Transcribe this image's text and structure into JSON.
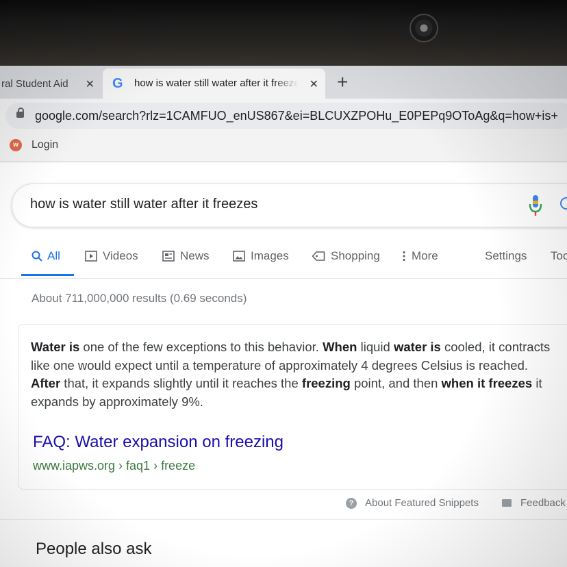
{
  "tabs": [
    {
      "label": "ral Student Aid",
      "close": "✕"
    },
    {
      "label": "how is water still water after it freezes",
      "close": "✕",
      "favicon": "G"
    }
  ],
  "new_tab": "+",
  "address_bar": {
    "url": "google.com/search?rlz=1CAMFUO_enUS867&ei=BLCUXZPOHu_E0PEPq9OToAg&q=how+is+"
  },
  "bookmarks": [
    {
      "label": "Login",
      "icon": "w"
    }
  ],
  "search": {
    "query": "how is water still water after it freezes"
  },
  "nav": {
    "tabs": [
      {
        "label": "All",
        "icon": "search-icon"
      },
      {
        "label": "Videos",
        "icon": "play-icon"
      },
      {
        "label": "News",
        "icon": "news-icon"
      },
      {
        "label": "Images",
        "icon": "image-icon"
      },
      {
        "label": "Shopping",
        "icon": "tag-icon"
      },
      {
        "label": "More",
        "icon": "more-vert-icon"
      }
    ],
    "settings": "Settings",
    "tools": "Too"
  },
  "result_stats": "About 711,000,000 results (0.69 seconds)",
  "snippet": {
    "parts": [
      {
        "b": "Water is"
      },
      {
        "t": " one of the few exceptions to this behavior. "
      },
      {
        "b": "When"
      },
      {
        "t": " liquid "
      },
      {
        "b": "water is"
      },
      {
        "t": " cooled, it contracts like one would expect until a temperature of approximately 4 degrees Celsius is reached. "
      },
      {
        "b": "After"
      },
      {
        "t": " that, it expands slightly until it reaches the "
      },
      {
        "b": "freezing"
      },
      {
        "t": " point, and then "
      },
      {
        "b": "when it freezes"
      },
      {
        "t": " it expands by approximately 9%."
      }
    ],
    "link_title": "FAQ: Water expansion on freezing",
    "cite": "www.iapws.org › faq1 › freeze"
  },
  "footer": {
    "about": "About Featured Snippets",
    "feedback": "Feedback"
  },
  "people_also_ask": "People also ask",
  "colors": {
    "link": "#1a0dab",
    "accent": "#1a73e8",
    "cite": "#3c7a40"
  }
}
